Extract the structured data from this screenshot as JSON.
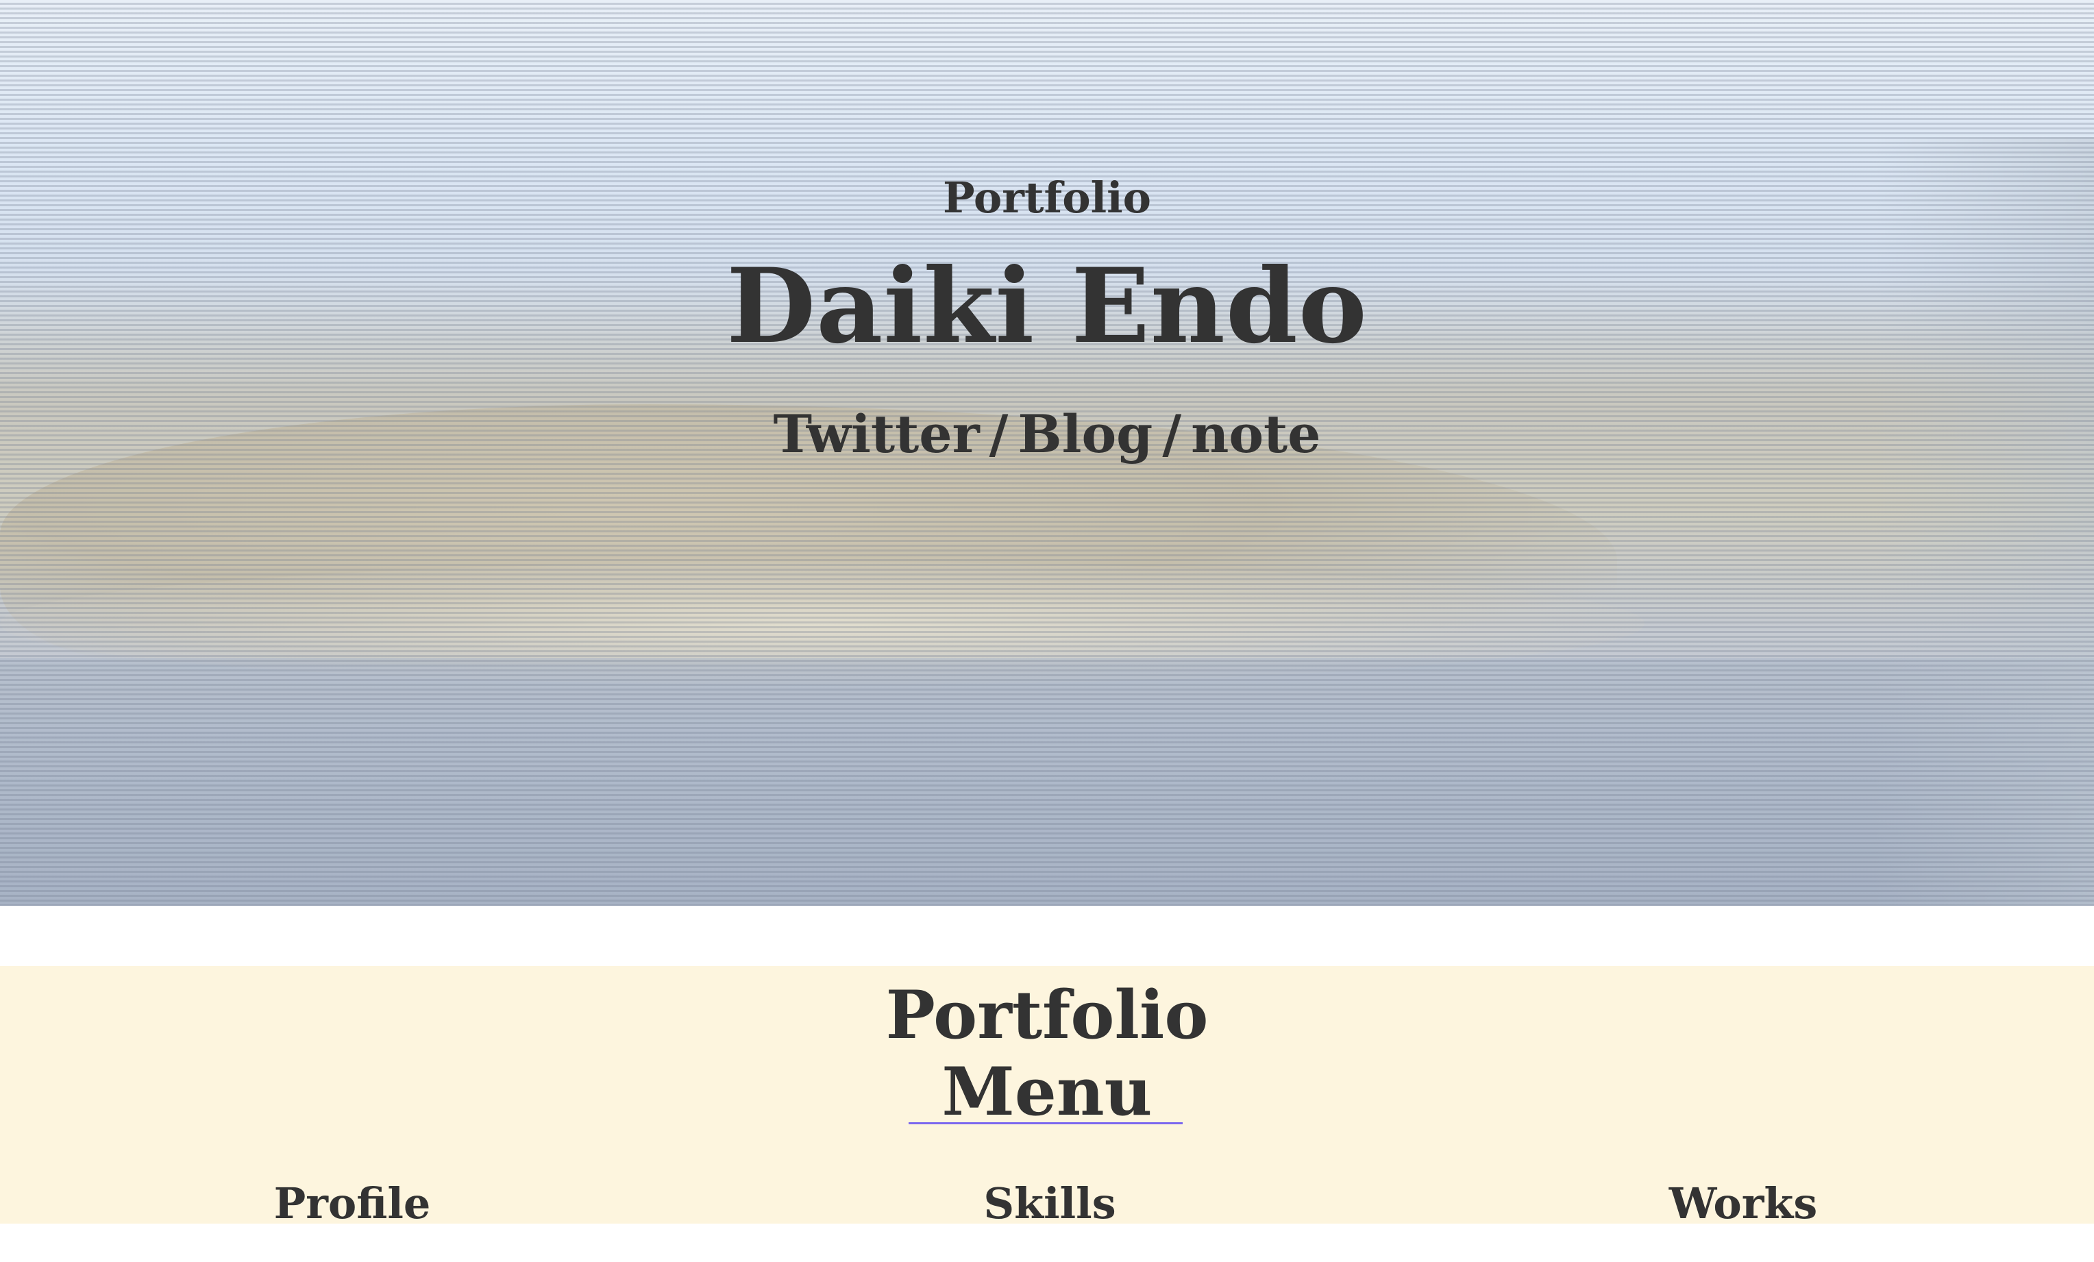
{
  "hero": {
    "kicker": "Portfolio",
    "title": "Daiki Endo",
    "links": [
      {
        "label": "Twitter"
      },
      {
        "label": "Blog"
      },
      {
        "label": "note"
      }
    ],
    "separator": "/"
  },
  "menu": {
    "title_line1": "Portfolio",
    "title_line2": "Menu",
    "items": [
      {
        "label": "Profile"
      },
      {
        "label": "Skills"
      },
      {
        "label": "Works"
      }
    ],
    "background_color": "#fdf5de",
    "underline_color": "#7b68ee"
  }
}
